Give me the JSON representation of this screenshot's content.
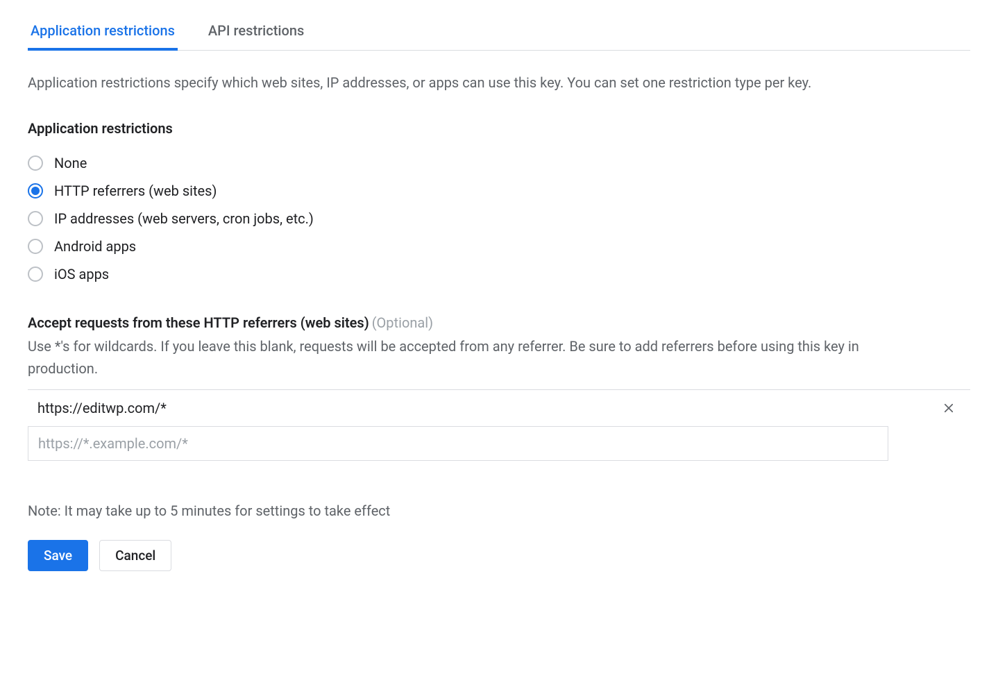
{
  "tabs": {
    "application": "Application restrictions",
    "api": "API restrictions"
  },
  "description": "Application restrictions specify which web sites, IP addresses, or apps can use this key. You can set one restriction type per key.",
  "restrictions": {
    "heading": "Application restrictions",
    "options": {
      "none": "None",
      "http": "HTTP referrers (web sites)",
      "ip": "IP addresses (web servers, cron jobs, etc.)",
      "android": "Android apps",
      "ios": "iOS apps"
    },
    "selected": "http"
  },
  "referrers": {
    "heading": "Accept requests from these HTTP referrers (web sites)",
    "optional": "(Optional)",
    "help": "Use *'s for wildcards. If you leave this blank, requests will be accepted from any referrer. Be sure to add referrers before using this key in production.",
    "entries": [
      "https://editwp.com/*"
    ],
    "input_placeholder": "https://*.example.com/*"
  },
  "note": "Note: It may take up to 5 minutes for settings to take effect",
  "buttons": {
    "save": "Save",
    "cancel": "Cancel"
  }
}
